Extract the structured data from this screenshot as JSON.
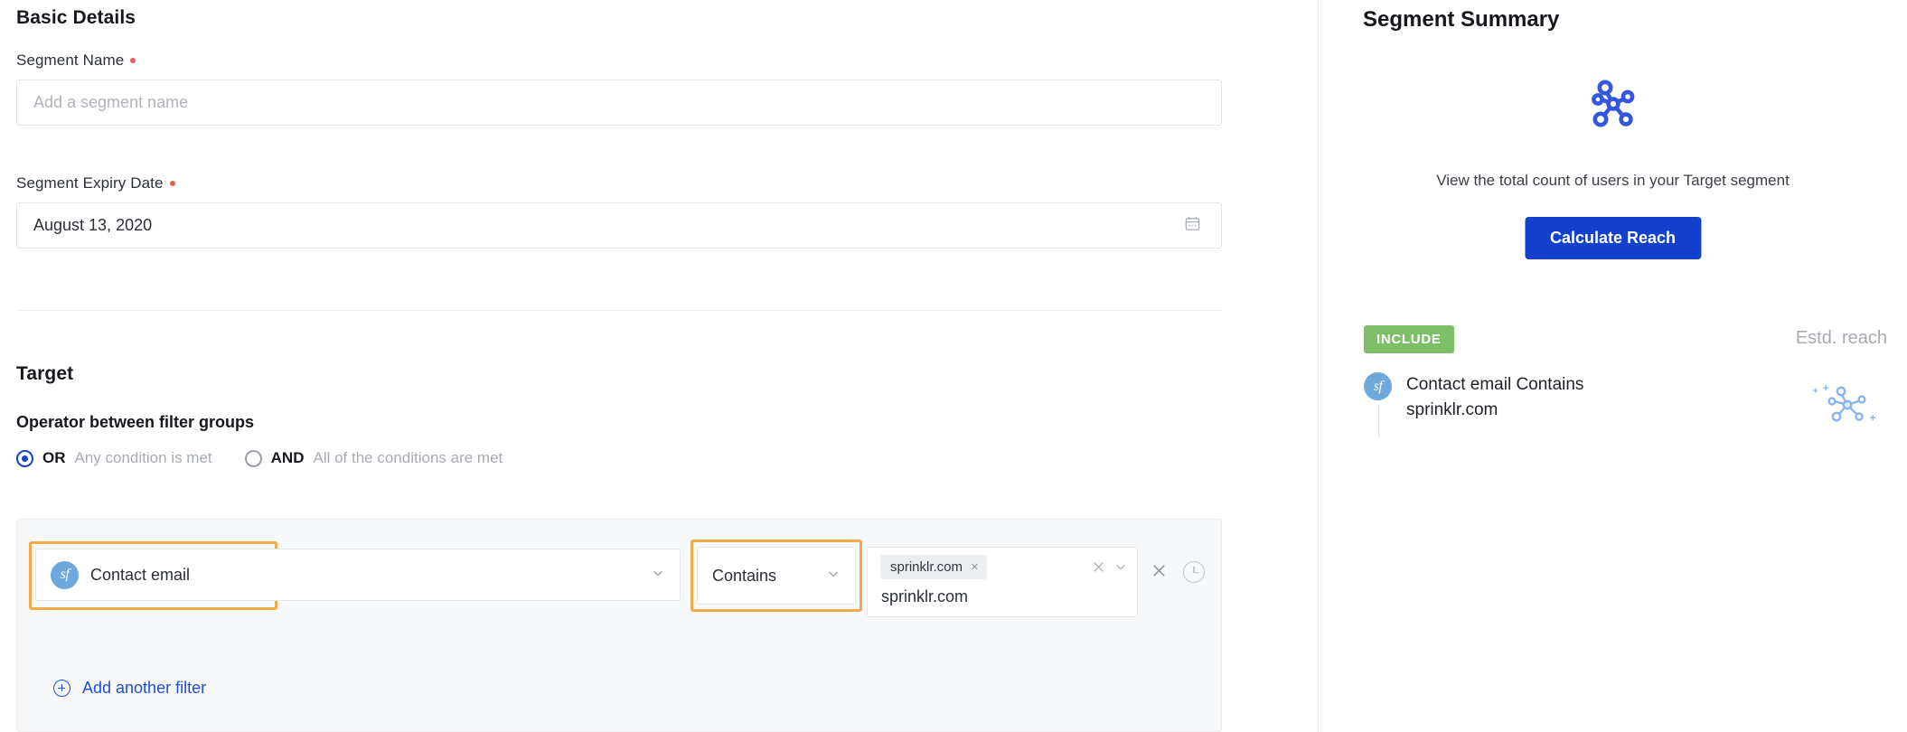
{
  "basic_details": {
    "section_title": "Basic Details",
    "segment_name": {
      "label": "Segment Name",
      "required": true,
      "value": "",
      "placeholder": "Add a segment name"
    },
    "segment_expiry_date": {
      "label": "Segment Expiry Date",
      "required": true,
      "value": "August 13, 2020",
      "icon": "calendar-icon"
    }
  },
  "target": {
    "section_title": "Target",
    "operator_label": "Operator between filter groups",
    "operator_options": [
      {
        "key": "OR",
        "description": "Any condition is met",
        "selected": true
      },
      {
        "key": "AND",
        "description": "All of the conditions are met",
        "selected": false
      }
    ],
    "filter_row": {
      "field": {
        "icon": "salesforce-icon",
        "icon_text": "sf",
        "value": "Contact email",
        "chevron": "chevron-down-icon",
        "highlighted": true
      },
      "operator": {
        "value": "Contains",
        "chevron": "chevron-down-icon",
        "highlighted": true
      },
      "value_field": {
        "chips": [
          {
            "label": "sprinklr.com",
            "remove": "×"
          }
        ],
        "clear_icon": "close-icon",
        "chevron": "chevron-down-icon",
        "suggestion": "sprinklr.com"
      },
      "actions": {
        "remove_icon": "close-icon",
        "history_icon": "clock-icon"
      }
    },
    "add_another_filter": {
      "label": "Add another filter",
      "icon": "plus-circle-icon"
    }
  },
  "summary": {
    "title": "Segment Summary",
    "illustration": "segment-network-icon",
    "description": "View the total count of users in your Target segment",
    "calculate_button": "Calculate Reach",
    "include_badge": "INCLUDE",
    "estd_reach_label": "Estd. reach",
    "estd_reach_illustration": "segment-network-faded-icon",
    "items": [
      {
        "icon": "salesforce-icon",
        "icon_text": "sf",
        "text": "Contact email Contains sprinklr.com"
      }
    ]
  },
  "colors": {
    "accent_blue": "#1340cc",
    "link_blue": "#1f4fd8",
    "highlight_orange": "#f5a94b",
    "include_green": "#7dbf68",
    "required_red": "#e8604f",
    "salesforce_blue": "#6ea8dc",
    "panel_bg": "#f7f8fa"
  }
}
